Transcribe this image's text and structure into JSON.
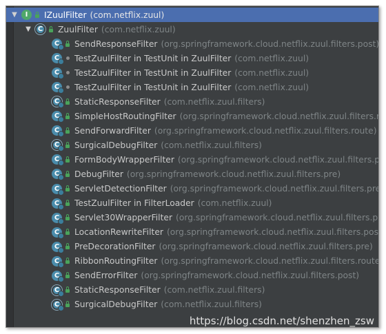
{
  "root": {
    "name": "IZuulFilter",
    "package": "(com.netflix.zuul)",
    "icon": "interface-icon",
    "expanded": true
  },
  "child": {
    "name": "ZuulFilter",
    "package": "(com.netflix.zuul)",
    "icon": "abstract-class-icon",
    "expanded": true
  },
  "items": [
    {
      "name": "SendResponseFilter",
      "package": "(org.springframework.cloud.netflix.zuul.filters.post)",
      "visibility": "public",
      "icon": "class-icon"
    },
    {
      "name": "TestZuulFilter in TestUnit in ZuulFilter",
      "package": "(com.netflix.zuul)",
      "visibility": "package",
      "icon": "class-icon"
    },
    {
      "name": "TestZuulFilter in TestUnit in ZuulFilter",
      "package": "(com.netflix.zuul)",
      "visibility": "package",
      "icon": "class-icon"
    },
    {
      "name": "TestZuulFilter in TestUnit in ZuulFilter",
      "package": "(com.netflix.zuul)",
      "visibility": "package",
      "icon": "class-icon"
    },
    {
      "name": "StaticResponseFilter",
      "package": "(com.netflix.zuul.filters)",
      "visibility": "public",
      "icon": "abstract-class-icon"
    },
    {
      "name": "SimpleHostRoutingFilter",
      "package": "(org.springframework.cloud.netflix.zuul.filters.route",
      "visibility": "public",
      "icon": "class-icon"
    },
    {
      "name": "SendForwardFilter",
      "package": "(org.springframework.cloud.netflix.zuul.filters.route)",
      "visibility": "public",
      "icon": "class-icon"
    },
    {
      "name": "SurgicalDebugFilter",
      "package": "(com.netflix.zuul.filters)",
      "visibility": "public",
      "icon": "abstract-class-icon"
    },
    {
      "name": "FormBodyWrapperFilter",
      "package": "(org.springframework.cloud.netflix.zuul.filters.pre)",
      "visibility": "public",
      "icon": "class-icon"
    },
    {
      "name": "DebugFilter",
      "package": "(org.springframework.cloud.netflix.zuul.filters.pre)",
      "visibility": "public",
      "icon": "class-icon"
    },
    {
      "name": "ServletDetectionFilter",
      "package": "(org.springframework.cloud.netflix.zuul.filters.pre)",
      "visibility": "public",
      "icon": "class-icon"
    },
    {
      "name": "TestZuulFilter in FilterLoader",
      "package": "(com.netflix.zuul)",
      "visibility": "public",
      "icon": "class-icon"
    },
    {
      "name": "Servlet30WrapperFilter",
      "package": "(org.springframework.cloud.netflix.zuul.filters.pre)",
      "visibility": "public",
      "icon": "class-icon"
    },
    {
      "name": "LocationRewriteFilter",
      "package": "(org.springframework.cloud.netflix.zuul.filters.post)",
      "visibility": "public",
      "icon": "class-icon"
    },
    {
      "name": "PreDecorationFilter",
      "package": "(org.springframework.cloud.netflix.zuul.filters.pre)",
      "visibility": "public",
      "icon": "class-icon"
    },
    {
      "name": "RibbonRoutingFilter",
      "package": "(org.springframework.cloud.netflix.zuul.filters.route)",
      "visibility": "public",
      "icon": "class-icon"
    },
    {
      "name": "SendErrorFilter",
      "package": "(org.springframework.cloud.netflix.zuul.filters.post)",
      "visibility": "public",
      "icon": "class-icon"
    },
    {
      "name": "StaticResponseFilter",
      "package": "(com.netflix.zuul.filters)",
      "visibility": "public",
      "icon": "abstract-class-icon"
    },
    {
      "name": "SurgicalDebugFilter",
      "package": "(com.netflix.zuul.filters)",
      "visibility": "public",
      "icon": "abstract-class-icon"
    }
  ],
  "watermark": "https://blog.csdn.net/shenzhen_zsw",
  "colors": {
    "panel_bg": "#3c3f41",
    "selection": "#4b6eaf",
    "class_icon": "#4a8cab",
    "interface_icon": "#4fa86a",
    "public_lock": "#4aa35b",
    "package_text": "#7f8587"
  }
}
